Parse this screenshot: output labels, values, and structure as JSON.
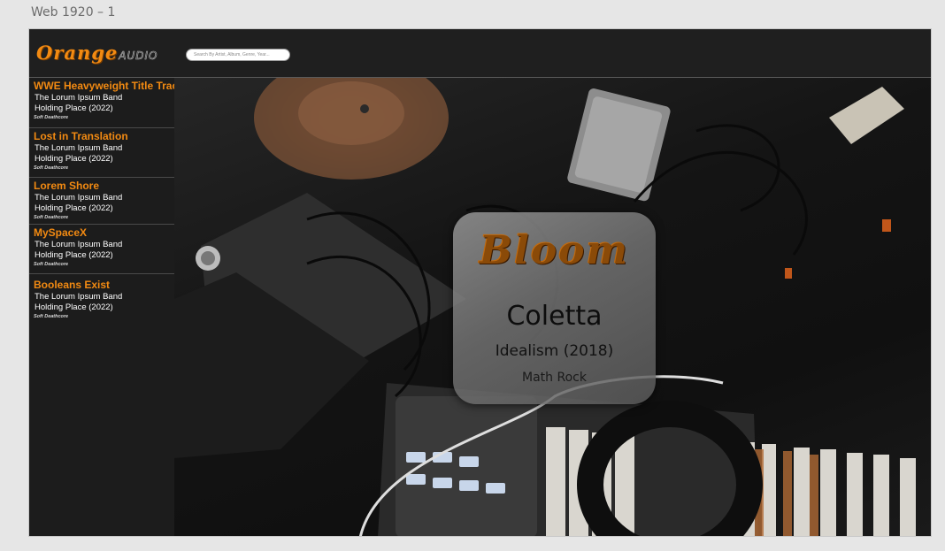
{
  "artboard_label": "Web 1920 – 1",
  "header": {
    "logo_main": "Orange",
    "logo_sub": "AUDIO",
    "search_placeholder": "Search By Artist, Album, Genre, Year..."
  },
  "tracks": [
    {
      "title": "WWE Heavyweight Title Track",
      "band": "The Lorum Ipsum Band",
      "album": "Holding Place (2022)",
      "genre": "Soft Deathcore"
    },
    {
      "title": "Lost in Translation",
      "band": "The Lorum Ipsum Band",
      "album": "Holding Place (2022)",
      "genre": "Soft Deathcore"
    },
    {
      "title": "Lorem Shore",
      "band": "The Lorum Ipsum Band",
      "album": "Holding Place (2022)",
      "genre": "Soft Deathcore"
    },
    {
      "title": "MySpaceX",
      "band": "The Lorum Ipsum Band",
      "album": "Holding Place (2022)",
      "genre": "Soft Deathcore"
    },
    {
      "title": "Booleans Exist",
      "band": "The Lorum Ipsum Band",
      "album": "Holding Place (2022)",
      "genre": "Soft Deathcore"
    }
  ],
  "player": {
    "brand": "Bloom",
    "artist": "Coletta",
    "album": "Idealism (2018)",
    "genre": "Math Rock"
  },
  "colors": {
    "accent": "#f28a12",
    "background": "#1b1b1b"
  }
}
